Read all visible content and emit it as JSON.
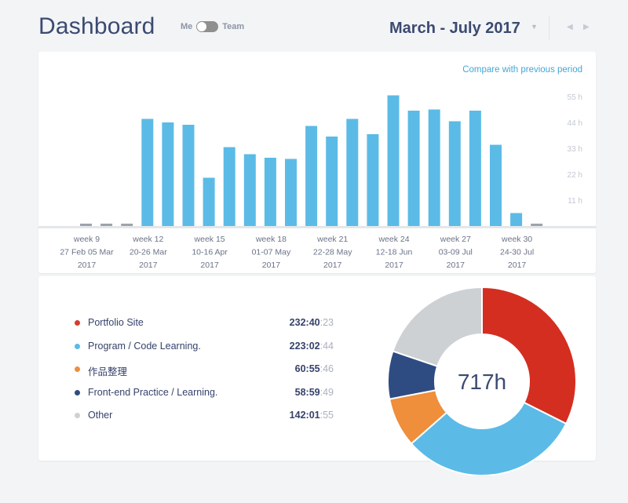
{
  "header": {
    "title": "Dashboard",
    "toggle_left": "Me",
    "toggle_right": "Team",
    "period": "March - July 2017",
    "caret_glyph": "▼",
    "prev_glyph": "◀",
    "next_glyph": "▶"
  },
  "chart": {
    "compare_link": "Compare with previous period"
  },
  "chart_data": {
    "type": "bar",
    "ylim": [
      0,
      55
    ],
    "y_ticks": [
      "55 h",
      "44 h",
      "33 h",
      "22 h",
      "11 h"
    ],
    "y_tick_values": [
      55,
      44,
      33,
      22,
      11
    ],
    "values": [
      1,
      1,
      1,
      45.5,
      44,
      43,
      20.5,
      33.5,
      30.5,
      29,
      28.5,
      42.5,
      38,
      45.5,
      39,
      55.5,
      49,
      49.5,
      44.5,
      49,
      34.5,
      5.5,
      1
    ],
    "week_labels": [
      {
        "week": "week 9",
        "range": "27 Feb 05 Mar",
        "year": "2017"
      },
      {
        "week": "week 12",
        "range": "20-26 Mar",
        "year": "2017"
      },
      {
        "week": "week 15",
        "range": "10-16 Apr",
        "year": "2017"
      },
      {
        "week": "week 18",
        "range": "01-07 May",
        "year": "2017"
      },
      {
        "week": "week 21",
        "range": "22-28 May",
        "year": "2017"
      },
      {
        "week": "week 24",
        "range": "12-18 Jun",
        "year": "2017"
      },
      {
        "week": "week 27",
        "range": "03-09 Jul",
        "year": "2017"
      },
      {
        "week": "week 30",
        "range": "24-30 Jul",
        "year": "2017"
      }
    ],
    "bar_color": "#5bbbe6",
    "empty_bar_color": "#9ea3ab"
  },
  "legend": {
    "items": [
      {
        "label": "Portfolio Site",
        "hm": "232:40",
        "sec": ":23",
        "color": "#d63b2f"
      },
      {
        "label": "Program / Code Learning.",
        "hm": "223:02",
        "sec": ":44",
        "color": "#5bbbe6"
      },
      {
        "label": "作品整理",
        "hm": "60:55",
        "sec": ":46",
        "color": "#ef8e3b"
      },
      {
        "label": "Front-end Practice / Learning.",
        "hm": "58:59",
        "sec": ":49",
        "color": "#2e4c82"
      },
      {
        "label": "Other",
        "hm": "142:01",
        "sec": ":55",
        "color": "#cdd1d4"
      }
    ]
  },
  "donut": {
    "total_label": "717h",
    "slices": [
      {
        "name": "Portfolio Site",
        "value": 232.67,
        "color": "#d42e21"
      },
      {
        "name": "Program / Code Learning.",
        "value": 223.05,
        "color": "#5bbbe6"
      },
      {
        "name": "作品整理",
        "value": 60.93,
        "color": "#ef8e3b"
      },
      {
        "name": "Front-end Practice / Learning.",
        "value": 58.99,
        "color": "#2e4c82"
      },
      {
        "name": "Other",
        "value": 142.03,
        "color": "#cdd1d4"
      }
    ]
  }
}
